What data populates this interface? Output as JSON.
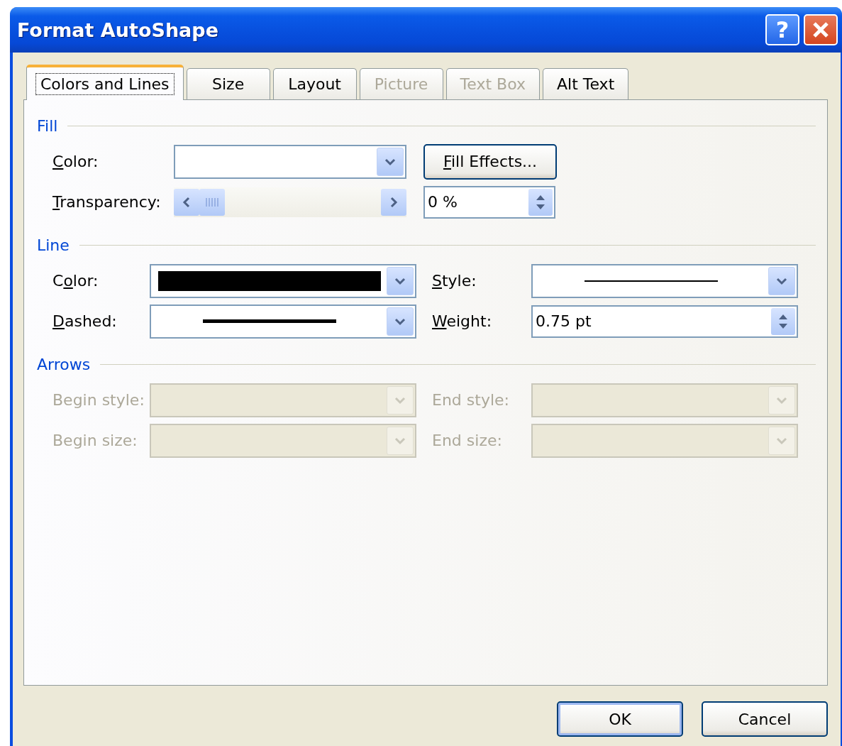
{
  "window": {
    "title": "Format AutoShape"
  },
  "title_buttons": [
    {
      "kind": "help",
      "label": "?"
    },
    {
      "kind": "close"
    }
  ],
  "tabs": [
    {
      "label": "Colors and Lines",
      "selected": true,
      "disabled": false
    },
    {
      "label": "Size",
      "selected": false,
      "disabled": false
    },
    {
      "label": "Layout",
      "selected": false,
      "disabled": false
    },
    {
      "label": "Picture",
      "selected": false,
      "disabled": true
    },
    {
      "label": "Text Box",
      "selected": false,
      "disabled": true
    },
    {
      "label": "Alt Text",
      "selected": false,
      "disabled": false
    }
  ],
  "sections": [
    {
      "heading": "Fill",
      "rows": [
        [
          {
            "kind": "combo",
            "label": [
              {
                "text": "C",
                "access_key": true
              },
              {
                "text": "olor:",
                "access_key": false
              }
            ],
            "disabled": false
          },
          {
            "kind": "button",
            "label": [
              {
                "text": "F",
                "access_key": true
              },
              {
                "text": "ill Effects...",
                "access_key": false
              }
            ]
          }
        ],
        [
          {
            "kind": "slider",
            "label": [
              {
                "text": "T",
                "access_key": true
              },
              {
                "text": "ransparency:",
                "access_key": false
              }
            ],
            "level": 0
          },
          {
            "kind": "spin",
            "value": "0 %"
          }
        ]
      ]
    },
    {
      "heading": "Line",
      "rows": [
        [
          {
            "kind": "combo",
            "label": [
              {
                "text": "C",
                "access_key": false
              },
              {
                "text": "o",
                "access_key": true
              },
              {
                "text": "lor:",
                "access_key": false
              }
            ],
            "disabled": false,
            "preview": {
              "kind": "swatch",
              "color": "#000000"
            }
          },
          {
            "kind": "combo",
            "label": [
              {
                "text": "S",
                "access_key": true
              },
              {
                "text": "tyle:",
                "access_key": false
              }
            ],
            "disabled": false,
            "preview": {
              "kind": "thin"
            }
          }
        ],
        [
          {
            "kind": "combo",
            "label": [
              {
                "text": "D",
                "access_key": true
              },
              {
                "text": "ashed:",
                "access_key": false
              }
            ],
            "disabled": false,
            "preview": {
              "kind": "thick"
            }
          },
          {
            "kind": "spin",
            "label": [
              {
                "text": "W",
                "access_key": true
              },
              {
                "text": "eight:",
                "access_key": false
              }
            ],
            "value": "0.75 pt"
          }
        ]
      ]
    },
    {
      "heading": "Arrows",
      "rows": [
        [
          {
            "kind": "combo",
            "label": [
              {
                "text": "Begin style:",
                "access_key": false
              }
            ],
            "disabled": true
          },
          {
            "kind": "combo",
            "label": [
              {
                "text": "End style:",
                "access_key": false
              }
            ],
            "disabled": true
          }
        ],
        [
          {
            "kind": "combo",
            "label": [
              {
                "text": "Begin size:",
                "access_key": false
              }
            ],
            "disabled": true
          },
          {
            "kind": "combo",
            "label": [
              {
                "text": "End size:",
                "access_key": false
              }
            ],
            "disabled": true
          }
        ]
      ]
    }
  ],
  "buttons": [
    {
      "label": "OK",
      "default": true
    },
    {
      "label": "Cancel",
      "default": false
    }
  ]
}
